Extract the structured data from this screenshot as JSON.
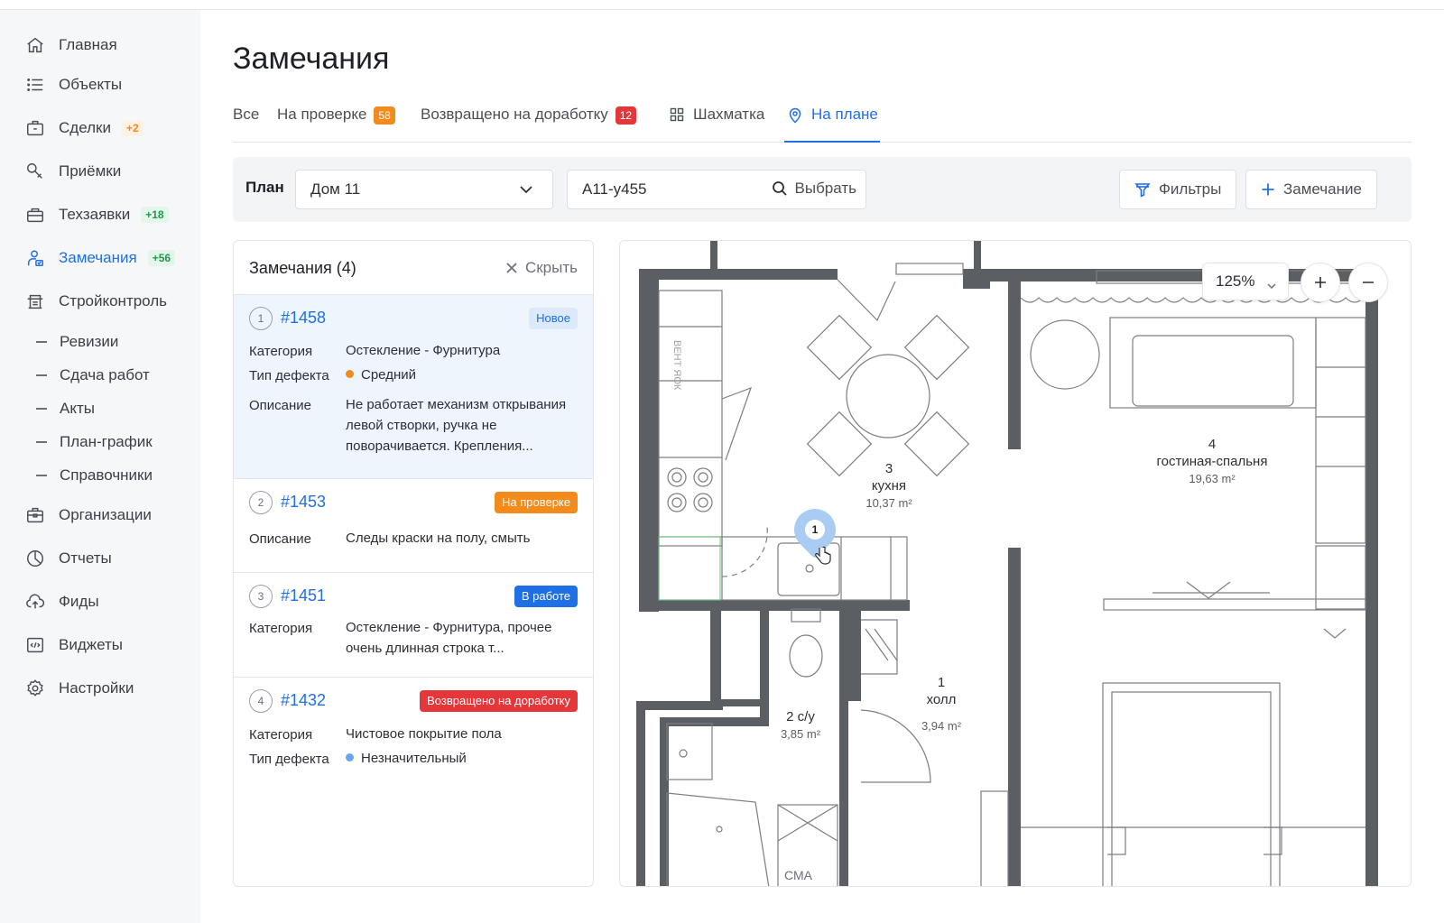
{
  "sidebar": {
    "items": [
      {
        "label": "Главная"
      },
      {
        "label": "Объекты"
      },
      {
        "label": "Сделки",
        "badge": "+2"
      },
      {
        "label": "Приёмки"
      },
      {
        "label": "Техзаявки",
        "badge": "+18"
      },
      {
        "label": "Замечания",
        "badge": "+56"
      },
      {
        "label": "Стройконтроль"
      },
      {
        "label": "Организации"
      },
      {
        "label": "Отчеты"
      },
      {
        "label": "Фиды"
      },
      {
        "label": "Виджеты"
      },
      {
        "label": "Настройки"
      }
    ],
    "subitems": [
      "Ревизии",
      "Сдача работ",
      "Акты",
      "План-график",
      "Справочники"
    ]
  },
  "page": {
    "title": "Замечания"
  },
  "tabs": [
    {
      "label": "Все"
    },
    {
      "label": "На проверке",
      "badge": "58"
    },
    {
      "label": "Возвращено на доработку",
      "badge": "12"
    },
    {
      "label": "Шахматка"
    },
    {
      "label": "На плане"
    }
  ],
  "toolbar": {
    "plan_label": "План",
    "plan_value": "Дом 11",
    "search_value": "А11-у455",
    "select_label": "Выбрать",
    "filters_label": "Фильтры",
    "add_label": "Замечание"
  },
  "remarks": {
    "title": "Замечания (4)",
    "hide_label": "Скрыть",
    "labels": {
      "category": "Категория",
      "defect_type": "Тип дефекта",
      "description": "Описание"
    },
    "cards": [
      {
        "num": "1",
        "id": "#1458",
        "status": "Новое",
        "category": "Остекление - Фурнитура",
        "defect_type": "Средний",
        "description": "Не работает механизм открывания левой створки, ручка не поворачивается. Крепления..."
      },
      {
        "num": "2",
        "id": "#1453",
        "status": "На проверке",
        "description": "Следы краски на полу, смыть"
      },
      {
        "num": "3",
        "id": "#1451",
        "status": "В работе",
        "category": "Остекление - Фурнитура, прочее очень длинная строка т..."
      },
      {
        "num": "4",
        "id": "#1432",
        "status": "Возвращено на доработку",
        "category": "Чистовое покрытие пола",
        "defect_type": "Незначительный"
      }
    ]
  },
  "plan": {
    "zoom": "125%",
    "marker_num": "1",
    "rooms": [
      {
        "num": "3",
        "name": "кухня",
        "area": "10,37 m²"
      },
      {
        "num": "4",
        "name": "гостиная-спальня",
        "area": "19,63 m²"
      },
      {
        "num": "1",
        "name": "холл",
        "area": "3,94 m²"
      },
      {
        "name": "2 с/у",
        "area": "3,85 m²"
      }
    ],
    "fixture_label": "СМА",
    "vent_label": "ВЕНТ ЯОК"
  },
  "colors": {
    "accent": "#1f6fe5",
    "badge_orange": "#f28a1c",
    "badge_red": "#e5363a",
    "badge_green": "#1e9a4c"
  }
}
